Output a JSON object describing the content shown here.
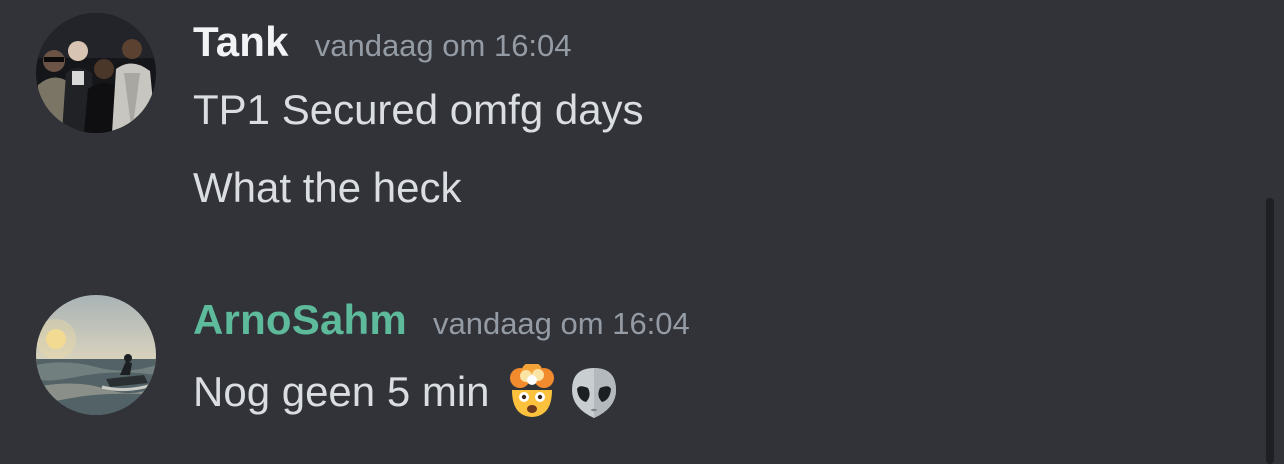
{
  "messages": [
    {
      "author": "Tank",
      "author_color": "#f2f3f5",
      "timestamp": "vandaag om 16:04",
      "avatar_icon": "group-photo-avatar",
      "lines": [
        "TP1 Secured omfg days",
        "What the heck"
      ]
    },
    {
      "author": "ArnoSahm",
      "author_color": "#5dba9b",
      "timestamp": "vandaag om 16:04",
      "avatar_icon": "jetski-sunset-avatar",
      "lines": [
        "Nog geen 5 min"
      ],
      "emojis": [
        "exploding-head-emoji",
        "alien-emoji"
      ]
    }
  ]
}
